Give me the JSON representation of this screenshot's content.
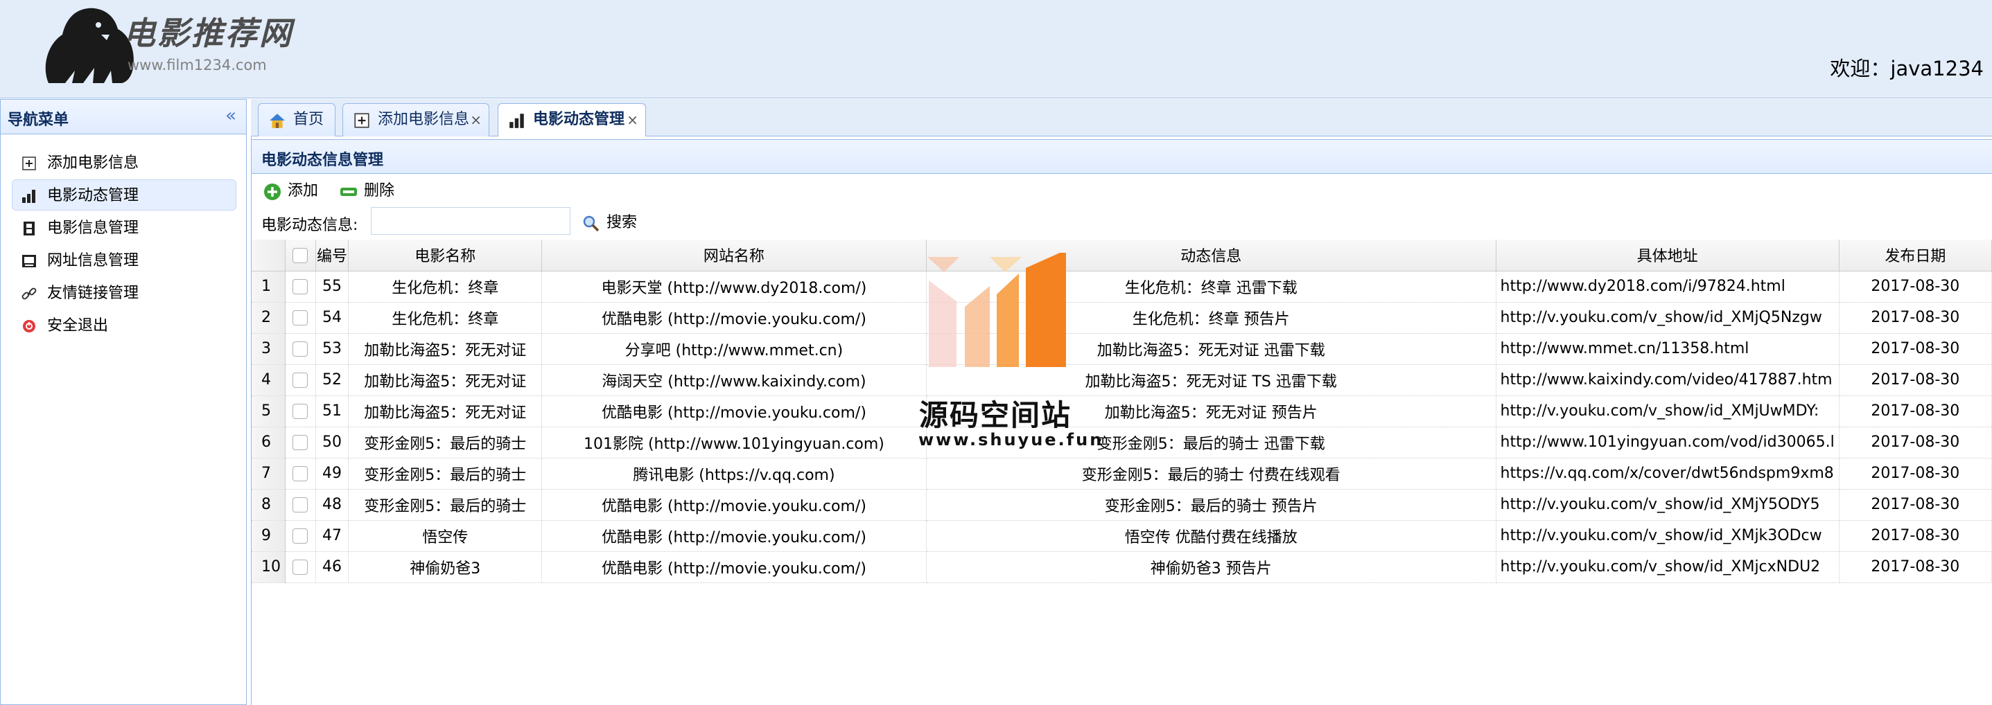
{
  "header": {
    "logo_title": "电影推荐网",
    "logo_url": "www.film1234.com",
    "welcome": "欢迎：java1234"
  },
  "sidebar": {
    "title": "导航菜单",
    "items": [
      {
        "label": "添加电影信息",
        "icon": "add-icon"
      },
      {
        "label": "电影动态管理",
        "icon": "bar-chart-icon"
      },
      {
        "label": "电影信息管理",
        "icon": "film-icon"
      },
      {
        "label": "网址信息管理",
        "icon": "monitor-icon"
      },
      {
        "label": "友情链接管理",
        "icon": "link-icon"
      },
      {
        "label": "安全退出",
        "icon": "exit-icon"
      }
    ]
  },
  "tabs": [
    {
      "label": "首页",
      "icon": "home-icon"
    },
    {
      "label": "添加电影信息",
      "icon": "add-icon",
      "close": "×"
    },
    {
      "label": "电影动态管理",
      "icon": "bar-chart-icon",
      "close": "×"
    }
  ],
  "panel": {
    "title": "电影动态信息管理",
    "add_label": "添加",
    "delete_label": "删除",
    "search_label": "电影动态信息:",
    "search_value": "",
    "search_button": "搜索"
  },
  "table": {
    "columns": [
      "编号",
      "电影名称",
      "网站名称",
      "动态信息",
      "具体地址",
      "发布日期"
    ],
    "rows": [
      {
        "num": "1",
        "id": "55",
        "movie": "生化危机：终章",
        "site": "电影天堂 (http://www.dy2018.com/)",
        "info": "生化危机：终章 迅雷下载",
        "url": "http://www.dy2018.com/i/97824.html",
        "date": "2017-08-30"
      },
      {
        "num": "2",
        "id": "54",
        "movie": "生化危机：终章",
        "site": "优酷电影 (http://movie.youku.com/)",
        "info": "生化危机：终章 预告片",
        "url": "http://v.youku.com/v_show/id_XMjQ5Nzgw",
        "date": "2017-08-30"
      },
      {
        "num": "3",
        "id": "53",
        "movie": "加勒比海盗5：死无对证",
        "site": "分享吧 (http://www.mmet.cn)",
        "info": "加勒比海盗5：死无对证 迅雷下载",
        "url": "http://www.mmet.cn/11358.html",
        "date": "2017-08-30"
      },
      {
        "num": "4",
        "id": "52",
        "movie": "加勒比海盗5：死无对证",
        "site": "海阔天空 (http://www.kaixindy.com)",
        "info": "加勒比海盗5：死无对证 TS 迅雷下载",
        "url": "http://www.kaixindy.com/video/417887.htm",
        "date": "2017-08-30"
      },
      {
        "num": "5",
        "id": "51",
        "movie": "加勒比海盗5：死无对证",
        "site": "优酷电影 (http://movie.youku.com/)",
        "info": "加勒比海盗5：死无对证 预告片",
        "url": "http://v.youku.com/v_show/id_XMjUwMDY:",
        "date": "2017-08-30"
      },
      {
        "num": "6",
        "id": "50",
        "movie": "变形金刚5：最后的骑士",
        "site": "101影院 (http://www.101yingyuan.com)",
        "info": "变形金刚5：最后的骑士 迅雷下载",
        "url": "http://www.101yingyuan.com/vod/id30065.l",
        "date": "2017-08-30"
      },
      {
        "num": "7",
        "id": "49",
        "movie": "变形金刚5：最后的骑士",
        "site": "腾讯电影 (https://v.qq.com)",
        "info": "变形金刚5：最后的骑士 付费在线观看",
        "url": "https://v.qq.com/x/cover/dwt56ndspm9xm8",
        "date": "2017-08-30"
      },
      {
        "num": "8",
        "id": "48",
        "movie": "变形金刚5：最后的骑士",
        "site": "优酷电影 (http://movie.youku.com/)",
        "info": "变形金刚5：最后的骑士 预告片",
        "url": "http://v.youku.com/v_show/id_XMjY5ODY5",
        "date": "2017-08-30"
      },
      {
        "num": "9",
        "id": "47",
        "movie": "悟空传",
        "site": "优酷电影 (http://movie.youku.com/)",
        "info": "悟空传 优酷付费在线播放",
        "url": "http://v.youku.com/v_show/id_XMjk3ODcw",
        "date": "2017-08-30"
      },
      {
        "num": "10",
        "id": "46",
        "movie": "神偷奶爸3",
        "site": "优酷电影 (http://movie.youku.com/)",
        "info": "神偷奶爸3 预告片",
        "url": "http://v.youku.com/v_show/id_XMjcxNDU2",
        "date": "2017-08-30"
      }
    ]
  },
  "watermark": {
    "text": "源码空间站",
    "url": "www.shuyue.fun"
  },
  "colors": {
    "header_bg": "#e3edf9",
    "border": "#95b8e7",
    "title_text": "#0e2d5f",
    "watermark_orange": "#f58220"
  }
}
